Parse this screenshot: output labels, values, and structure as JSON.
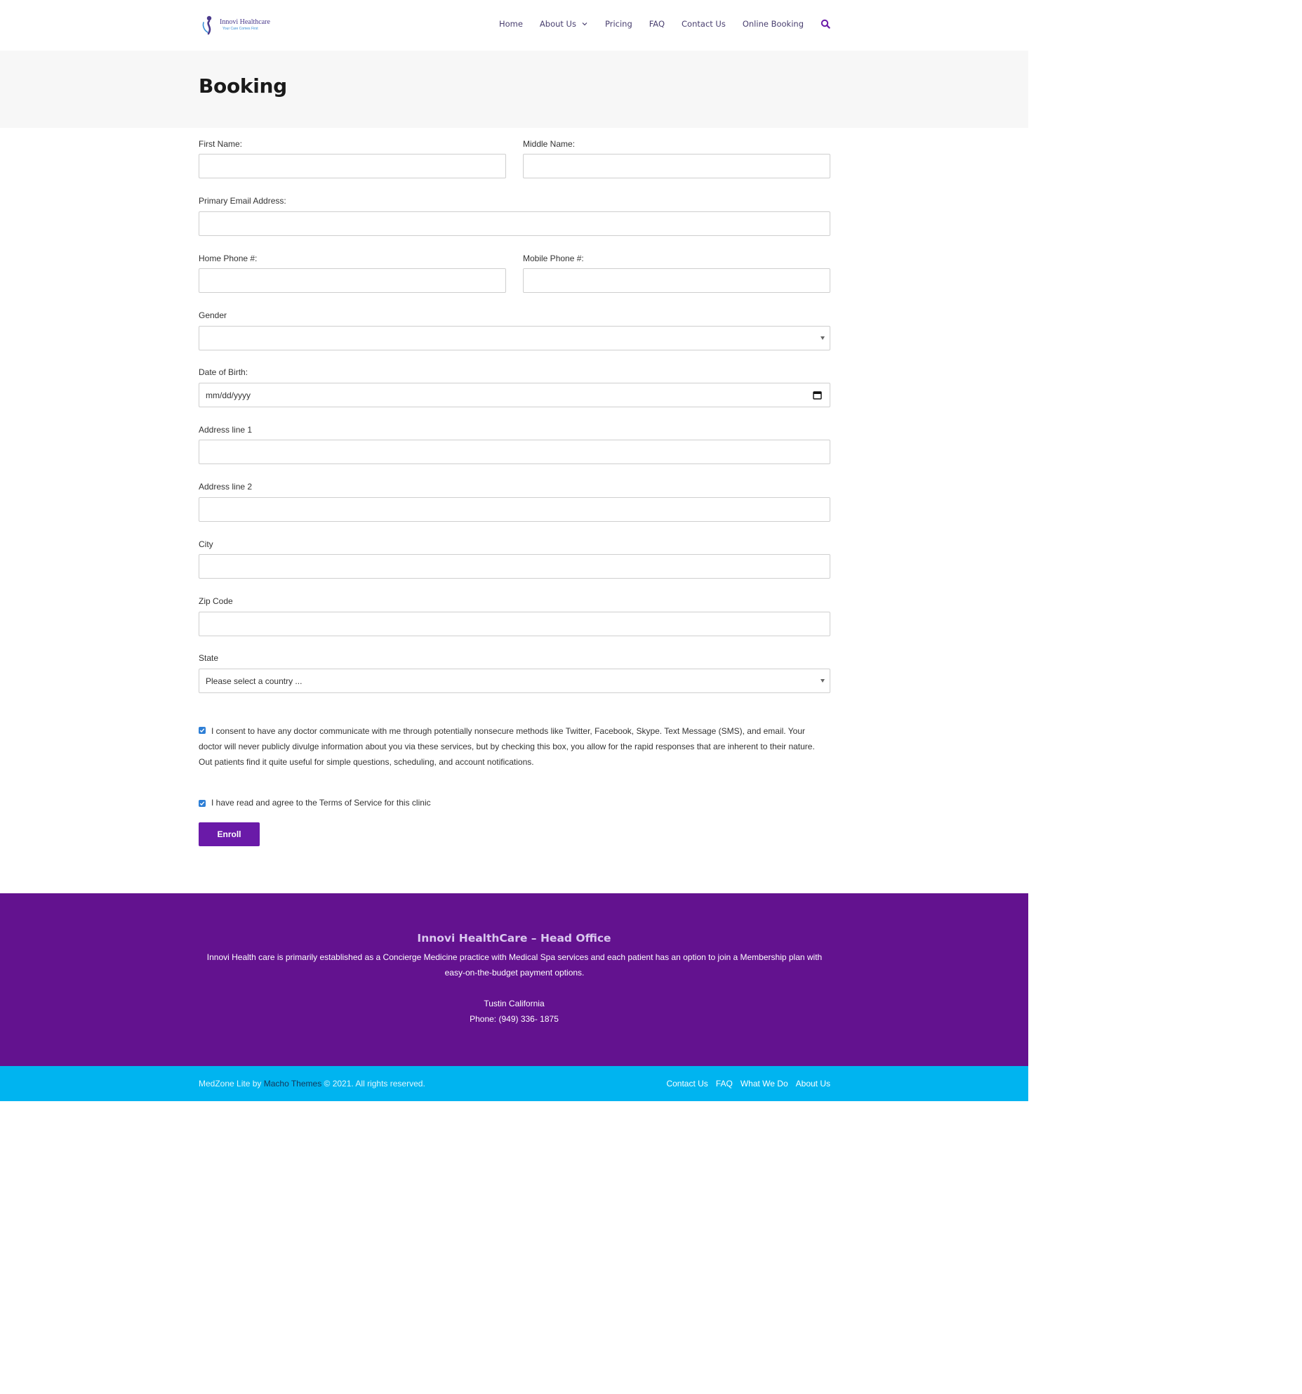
{
  "header": {
    "logo_name": "Innovi Healthcare",
    "logo_tagline": "Your Care Comes First",
    "nav": [
      "Home",
      "About Us",
      "Pricing",
      "FAQ",
      "Contact Us",
      "Online Booking"
    ]
  },
  "page": {
    "title": "Booking"
  },
  "form": {
    "first_name_label": "First Name:",
    "middle_name_label": "Middle Name:",
    "email_label": "Primary Email Address:",
    "home_phone_label": "Home Phone #:",
    "mobile_phone_label": "Mobile Phone #:",
    "gender_label": "Gender",
    "gender_value": "",
    "dob_label": "Date of Birth:",
    "dob_placeholder": "mm/dd/yyyy",
    "address1_label": "Address line 1",
    "address2_label": "Address line 2",
    "city_label": "City",
    "zip_label": "Zip Code",
    "state_label": "State",
    "state_value": "Please select a country ...",
    "consent_text": "I consent to have any doctor communicate with me through potentially nonsecure methods like Twitter, Facebook, Skype. Text Message (SMS), and email. Your doctor will never publicly divulge information about you via these services, but by checking this box, you allow for the rapid responses that are inherent to their nature. Out patients find it quite useful for simple questions, scheduling, and account notifications.",
    "consent_checked": true,
    "terms_text": "I have read and agree to the Terms of Service for this clinic",
    "terms_checked": true,
    "enroll_label": "Enroll"
  },
  "footer": {
    "title": "Innovi HealthCare – Head Office",
    "description": "Innovi Health care is primarily established as a Concierge Medicine practice with Medical Spa services and each patient has an option to join a Membership plan with easy-on-the-budget payment options.",
    "location": "Tustin California",
    "phone": "Phone: (949) 336- 1875"
  },
  "bottom_bar": {
    "copyright_prefix": "MedZone Lite by ",
    "copyright_link": "Macho Themes",
    "copyright_suffix": " © 2021. All rights reserved.",
    "links": [
      "Contact Us",
      "FAQ",
      "What We Do",
      "About Us"
    ]
  },
  "colors": {
    "accent": "#6a1aa8",
    "footer_bg": "#63128f",
    "bottom_bar_bg": "#00b4f0",
    "checkbox": "#2e7fd6"
  },
  "icons": [
    "logo-mark-icon",
    "chevron-down-icon",
    "search-icon",
    "calendar-icon",
    "checkbox-check-icon"
  ]
}
